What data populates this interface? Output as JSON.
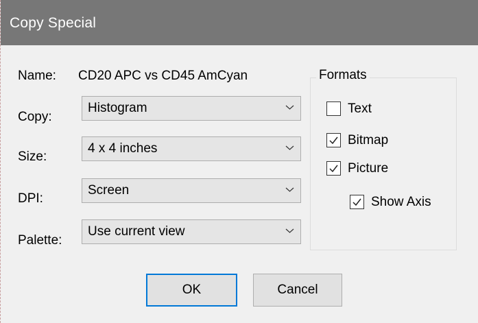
{
  "window": {
    "title": "Copy Special"
  },
  "name_row": {
    "label": "Name:",
    "value": "CD20 APC vs CD45 AmCyan"
  },
  "fields": {
    "copy": {
      "label": "Copy:",
      "value": "Histogram"
    },
    "size": {
      "label": "Size:",
      "value": "4 x 4 inches"
    },
    "dpi": {
      "label": "DPI:",
      "value": "Screen"
    },
    "palette": {
      "label": "Palette:",
      "value": "Use current view"
    }
  },
  "formats": {
    "title": "Formats",
    "text": {
      "label": "Text",
      "checked": false
    },
    "bitmap": {
      "label": "Bitmap",
      "checked": true
    },
    "picture": {
      "label": "Picture",
      "checked": true
    },
    "show_axis": {
      "label": "Show Axis",
      "checked": true
    }
  },
  "buttons": {
    "ok": "OK",
    "cancel": "Cancel"
  },
  "colors": {
    "titlebar": "#777777",
    "dialog_bg": "#f0f0f0",
    "default_button_border": "#0078d7"
  },
  "icons": {
    "dropdown": "chevron-down-icon",
    "check": "checkmark-icon"
  }
}
